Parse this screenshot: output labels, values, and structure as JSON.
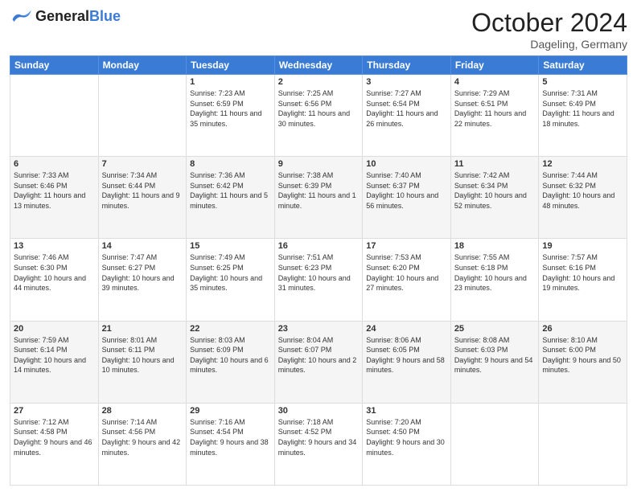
{
  "header": {
    "logo": {
      "general": "General",
      "blue": "Blue"
    },
    "title": "October 2024",
    "location": "Dageling, Germany"
  },
  "weekdays": [
    "Sunday",
    "Monday",
    "Tuesday",
    "Wednesday",
    "Thursday",
    "Friday",
    "Saturday"
  ],
  "weeks": [
    [
      null,
      null,
      {
        "day": "1",
        "sunrise": "Sunrise: 7:23 AM",
        "sunset": "Sunset: 6:59 PM",
        "daylight": "Daylight: 11 hours and 35 minutes."
      },
      {
        "day": "2",
        "sunrise": "Sunrise: 7:25 AM",
        "sunset": "Sunset: 6:56 PM",
        "daylight": "Daylight: 11 hours and 30 minutes."
      },
      {
        "day": "3",
        "sunrise": "Sunrise: 7:27 AM",
        "sunset": "Sunset: 6:54 PM",
        "daylight": "Daylight: 11 hours and 26 minutes."
      },
      {
        "day": "4",
        "sunrise": "Sunrise: 7:29 AM",
        "sunset": "Sunset: 6:51 PM",
        "daylight": "Daylight: 11 hours and 22 minutes."
      },
      {
        "day": "5",
        "sunrise": "Sunrise: 7:31 AM",
        "sunset": "Sunset: 6:49 PM",
        "daylight": "Daylight: 11 hours and 18 minutes."
      }
    ],
    [
      {
        "day": "6",
        "sunrise": "Sunrise: 7:33 AM",
        "sunset": "Sunset: 6:46 PM",
        "daylight": "Daylight: 11 hours and 13 minutes."
      },
      {
        "day": "7",
        "sunrise": "Sunrise: 7:34 AM",
        "sunset": "Sunset: 6:44 PM",
        "daylight": "Daylight: 11 hours and 9 minutes."
      },
      {
        "day": "8",
        "sunrise": "Sunrise: 7:36 AM",
        "sunset": "Sunset: 6:42 PM",
        "daylight": "Daylight: 11 hours and 5 minutes."
      },
      {
        "day": "9",
        "sunrise": "Sunrise: 7:38 AM",
        "sunset": "Sunset: 6:39 PM",
        "daylight": "Daylight: 11 hours and 1 minute."
      },
      {
        "day": "10",
        "sunrise": "Sunrise: 7:40 AM",
        "sunset": "Sunset: 6:37 PM",
        "daylight": "Daylight: 10 hours and 56 minutes."
      },
      {
        "day": "11",
        "sunrise": "Sunrise: 7:42 AM",
        "sunset": "Sunset: 6:34 PM",
        "daylight": "Daylight: 10 hours and 52 minutes."
      },
      {
        "day": "12",
        "sunrise": "Sunrise: 7:44 AM",
        "sunset": "Sunset: 6:32 PM",
        "daylight": "Daylight: 10 hours and 48 minutes."
      }
    ],
    [
      {
        "day": "13",
        "sunrise": "Sunrise: 7:46 AM",
        "sunset": "Sunset: 6:30 PM",
        "daylight": "Daylight: 10 hours and 44 minutes."
      },
      {
        "day": "14",
        "sunrise": "Sunrise: 7:47 AM",
        "sunset": "Sunset: 6:27 PM",
        "daylight": "Daylight: 10 hours and 39 minutes."
      },
      {
        "day": "15",
        "sunrise": "Sunrise: 7:49 AM",
        "sunset": "Sunset: 6:25 PM",
        "daylight": "Daylight: 10 hours and 35 minutes."
      },
      {
        "day": "16",
        "sunrise": "Sunrise: 7:51 AM",
        "sunset": "Sunset: 6:23 PM",
        "daylight": "Daylight: 10 hours and 31 minutes."
      },
      {
        "day": "17",
        "sunrise": "Sunrise: 7:53 AM",
        "sunset": "Sunset: 6:20 PM",
        "daylight": "Daylight: 10 hours and 27 minutes."
      },
      {
        "day": "18",
        "sunrise": "Sunrise: 7:55 AM",
        "sunset": "Sunset: 6:18 PM",
        "daylight": "Daylight: 10 hours and 23 minutes."
      },
      {
        "day": "19",
        "sunrise": "Sunrise: 7:57 AM",
        "sunset": "Sunset: 6:16 PM",
        "daylight": "Daylight: 10 hours and 19 minutes."
      }
    ],
    [
      {
        "day": "20",
        "sunrise": "Sunrise: 7:59 AM",
        "sunset": "Sunset: 6:14 PM",
        "daylight": "Daylight: 10 hours and 14 minutes."
      },
      {
        "day": "21",
        "sunrise": "Sunrise: 8:01 AM",
        "sunset": "Sunset: 6:11 PM",
        "daylight": "Daylight: 10 hours and 10 minutes."
      },
      {
        "day": "22",
        "sunrise": "Sunrise: 8:03 AM",
        "sunset": "Sunset: 6:09 PM",
        "daylight": "Daylight: 10 hours and 6 minutes."
      },
      {
        "day": "23",
        "sunrise": "Sunrise: 8:04 AM",
        "sunset": "Sunset: 6:07 PM",
        "daylight": "Daylight: 10 hours and 2 minutes."
      },
      {
        "day": "24",
        "sunrise": "Sunrise: 8:06 AM",
        "sunset": "Sunset: 6:05 PM",
        "daylight": "Daylight: 9 hours and 58 minutes."
      },
      {
        "day": "25",
        "sunrise": "Sunrise: 8:08 AM",
        "sunset": "Sunset: 6:03 PM",
        "daylight": "Daylight: 9 hours and 54 minutes."
      },
      {
        "day": "26",
        "sunrise": "Sunrise: 8:10 AM",
        "sunset": "Sunset: 6:00 PM",
        "daylight": "Daylight: 9 hours and 50 minutes."
      }
    ],
    [
      {
        "day": "27",
        "sunrise": "Sunrise: 7:12 AM",
        "sunset": "Sunset: 4:58 PM",
        "daylight": "Daylight: 9 hours and 46 minutes."
      },
      {
        "day": "28",
        "sunrise": "Sunrise: 7:14 AM",
        "sunset": "Sunset: 4:56 PM",
        "daylight": "Daylight: 9 hours and 42 minutes."
      },
      {
        "day": "29",
        "sunrise": "Sunrise: 7:16 AM",
        "sunset": "Sunset: 4:54 PM",
        "daylight": "Daylight: 9 hours and 38 minutes."
      },
      {
        "day": "30",
        "sunrise": "Sunrise: 7:18 AM",
        "sunset": "Sunset: 4:52 PM",
        "daylight": "Daylight: 9 hours and 34 minutes."
      },
      {
        "day": "31",
        "sunrise": "Sunrise: 7:20 AM",
        "sunset": "Sunset: 4:50 PM",
        "daylight": "Daylight: 9 hours and 30 minutes."
      },
      null,
      null
    ]
  ]
}
